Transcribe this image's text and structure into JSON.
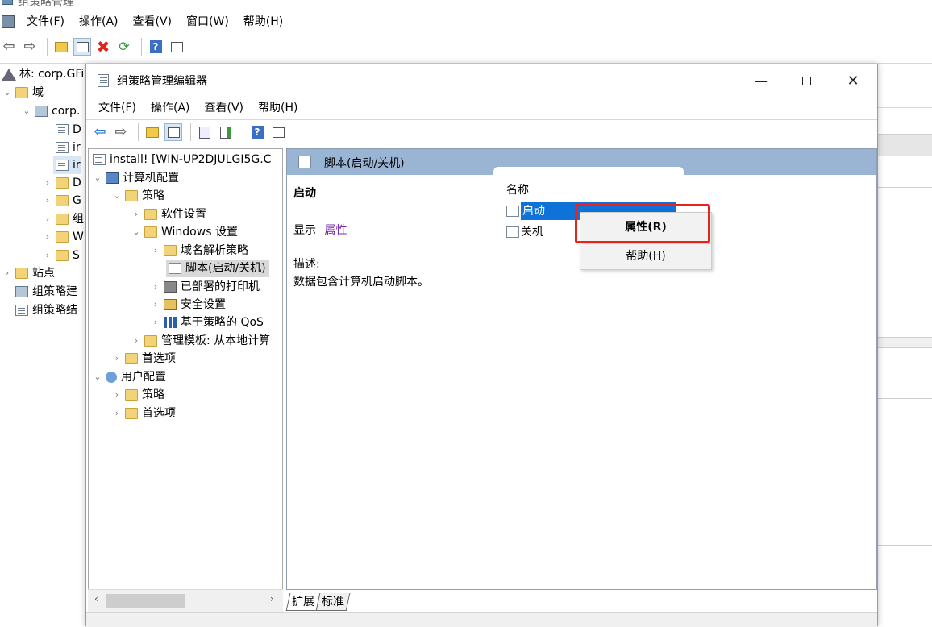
{
  "outer": {
    "title": "组策略管理",
    "menu": [
      "文件(F)",
      "操作(A)",
      "查看(V)",
      "窗口(W)",
      "帮助(H)"
    ],
    "tree": [
      {
        "label": "林: corp.GFi",
        "icon": "forest-icon"
      },
      {
        "label": "域",
        "icon": "domains-folder-icon"
      },
      {
        "label": "corp.",
        "icon": "domain-icon"
      },
      {
        "label": "D",
        "icon": "gpo-link-icon"
      },
      {
        "label": "ir",
        "icon": "gpo-link-icon"
      },
      {
        "label": "ir",
        "icon": "gpo-link-icon"
      },
      {
        "label": "D",
        "icon": "ou-folder-icon"
      },
      {
        "label": "G",
        "icon": "ou-folder-icon"
      },
      {
        "label": "组",
        "icon": "ou-folder-icon"
      },
      {
        "label": "W",
        "icon": "ou-folder-icon"
      },
      {
        "label": "S",
        "icon": "ou-folder-icon"
      },
      {
        "label": "站点",
        "icon": "sites-icon"
      },
      {
        "label": "组策略建",
        "icon": "gp-modeling-icon"
      },
      {
        "label": "组策略结",
        "icon": "gp-results-icon"
      }
    ]
  },
  "editor": {
    "title": "组策略管理编辑器",
    "menu": [
      "文件(F)",
      "操作(A)",
      "查看(V)",
      "帮助(H)"
    ],
    "tree": {
      "root": "install!  [WIN-UP2DJULGI5G.C",
      "computer_config": "计算机配置",
      "policies": "策略",
      "software_settings": "软件设置",
      "windows_settings": "Windows 设置",
      "dns_policy": "域名解析策略",
      "scripts": "脚本(启动/关机)",
      "deployed_printers": "已部署的打印机",
      "security_settings": "安全设置",
      "qos": "基于策略的 QoS",
      "admin_templates": "管理模板: 从本地计算",
      "preferences": "首选项",
      "user_config": "用户配置",
      "user_policies": "策略",
      "user_preferences": "首选项"
    },
    "right": {
      "header": "脚本(启动/关机)",
      "section_title": "启动",
      "show_label": "显示",
      "properties_link": "属性",
      "desc_label": "描述:",
      "desc_text": "数据包含计算机启动脚本。",
      "column_name": "名称",
      "items": [
        "启动",
        "关机"
      ]
    },
    "tabs": [
      "扩展",
      "标准"
    ]
  },
  "context_menu": {
    "properties": "属性(R)",
    "help": "帮助(H)"
  },
  "colors": {
    "header_blue": "#9ab4d3",
    "selection_blue": "#0e72d8",
    "highlight_red": "#e8231b"
  }
}
